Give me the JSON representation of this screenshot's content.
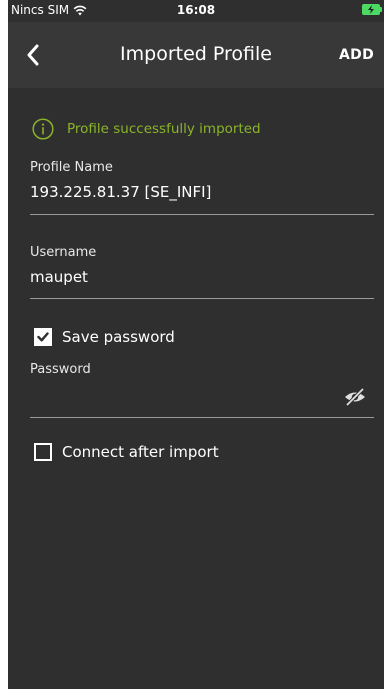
{
  "status_bar": {
    "carrier": "Nincs SIM",
    "time": "16:08",
    "wifi_icon": "wifi-icon",
    "battery_icon": "battery-charging-icon",
    "battery_color": "#4cd964"
  },
  "nav": {
    "back_icon": "chevron-left-icon",
    "title": "Imported Profile",
    "add_label": "ADD"
  },
  "notice": {
    "icon": "info-icon",
    "text": "Profile successfully imported",
    "color": "#8ab42a"
  },
  "form": {
    "profile_name": {
      "label": "Profile Name",
      "value": "193.225.81.37 [SE_INFI]"
    },
    "username": {
      "label": "Username",
      "value": "maupet"
    },
    "save_password": {
      "label": "Save password",
      "checked": true
    },
    "password": {
      "label": "Password",
      "value": "",
      "visibility_icon": "eye-off-icon"
    },
    "connect_after_import": {
      "label": "Connect after import",
      "checked": false
    }
  },
  "colors": {
    "background": "#2f2f2f",
    "nav_background": "#383838",
    "accent": "#8ab42a"
  }
}
